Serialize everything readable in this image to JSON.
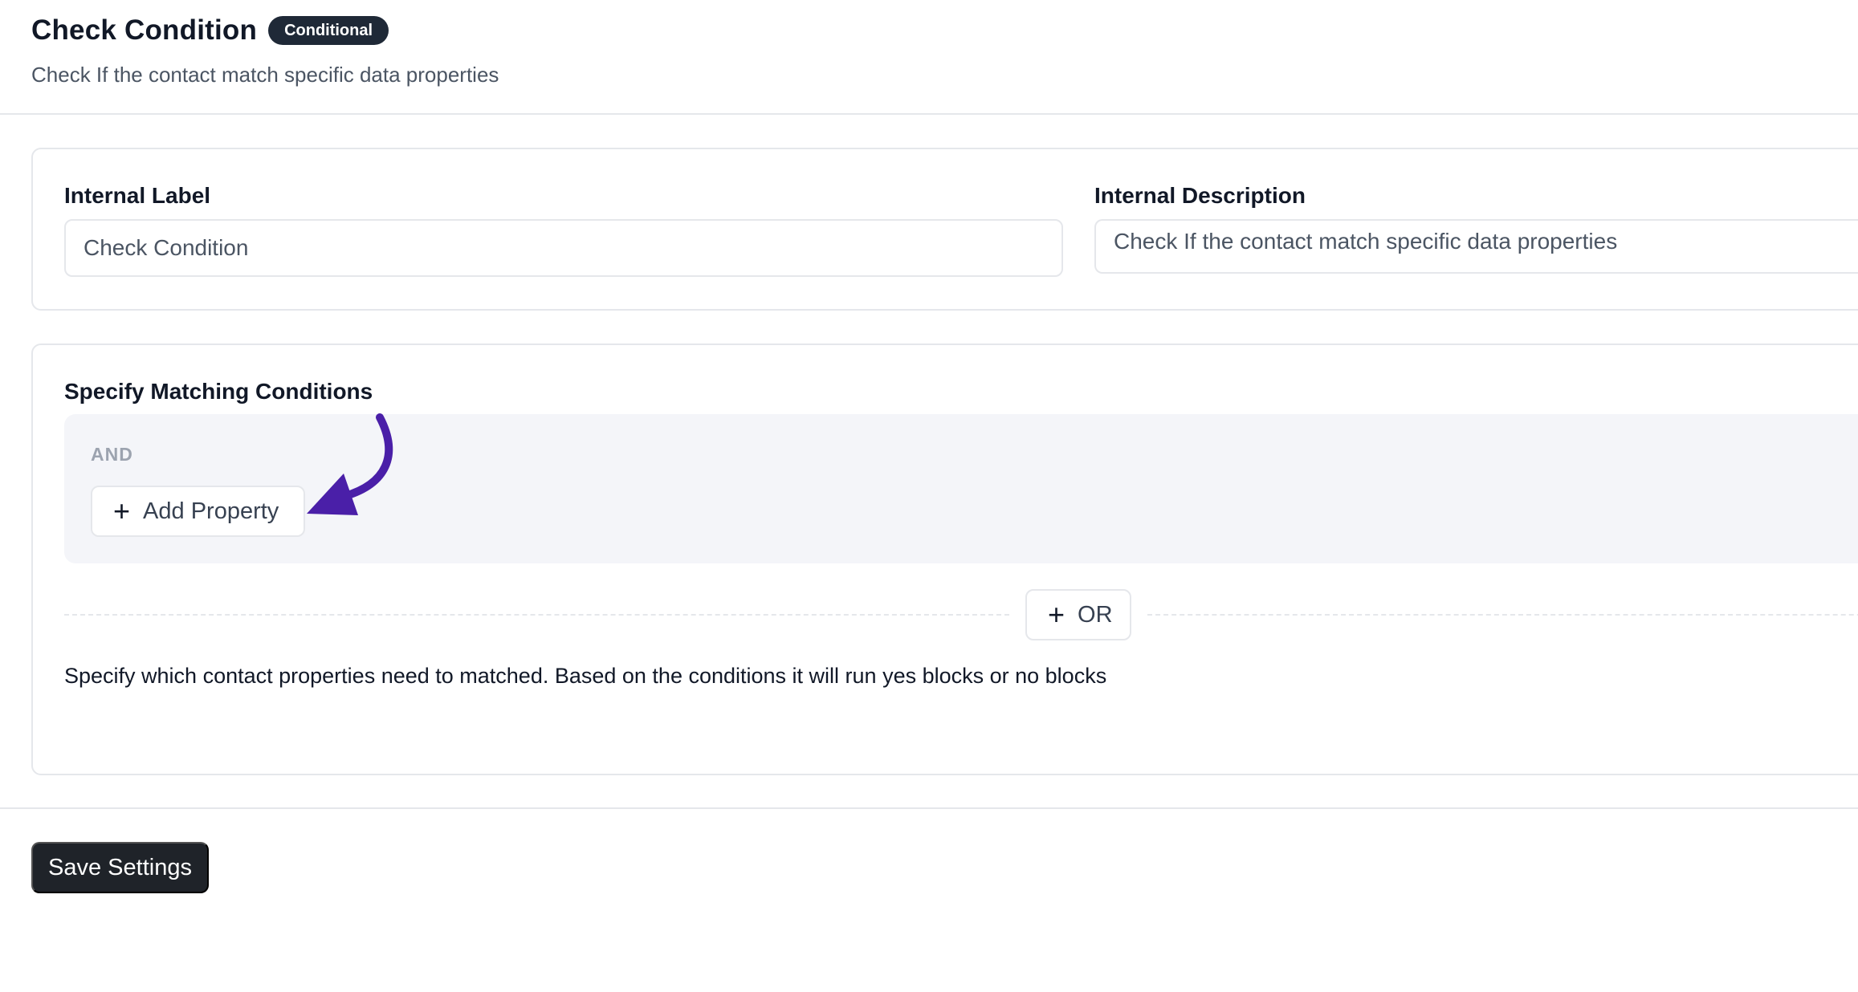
{
  "header": {
    "title": "Check Condition",
    "badge": "Conditional",
    "subtitle": "Check If the contact match specific data properties"
  },
  "fields": {
    "internal_label": {
      "label": "Internal Label",
      "value": "Check Condition"
    },
    "internal_description": {
      "label": "Internal Description",
      "value": "Check If the contact match specific data properties"
    }
  },
  "conditions": {
    "label": "Specify Matching Conditions",
    "group_operator": "AND",
    "add_property_label": "Add Property",
    "or_label": "OR",
    "helper_text": "Specify which contact properties need to matched. Based on the conditions it will run yes blocks or no blocks"
  },
  "footer": {
    "save_label": "Save Settings"
  },
  "icons": {
    "plus": "plus-icon",
    "annotation_arrow": "arrow-annotation"
  },
  "colors": {
    "primary_dark": "#1f2329",
    "annotation_arrow": "#4a1fa8",
    "group_background": "#f4f5f9"
  }
}
